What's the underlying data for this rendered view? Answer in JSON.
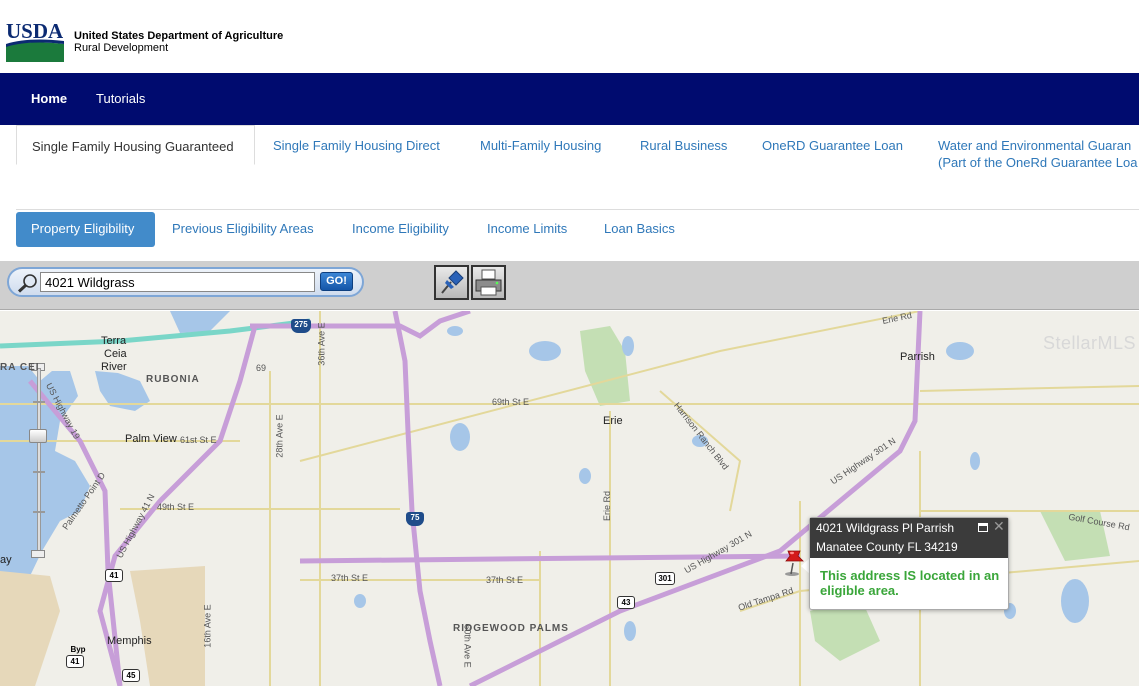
{
  "header": {
    "logo_text": "USDA",
    "agency_line1": "United States Department of Agriculture",
    "agency_line2": "Rural Development"
  },
  "nav": {
    "home": "Home",
    "tutorials": "Tutorials"
  },
  "program_tabs": [
    {
      "label": "Single Family Housing Guaranteed"
    },
    {
      "label": "Single Family Housing Direct"
    },
    {
      "label": "Multi-Family Housing"
    },
    {
      "label": "Rural Business"
    },
    {
      "label": "OneRD Guarantee Loan"
    },
    {
      "label": "Water and Environmental Guaran",
      "label2": "(Part of the OneRd Guarantee Loa"
    }
  ],
  "sub_tabs": [
    {
      "label": "Property Eligibility"
    },
    {
      "label": "Previous Eligibility Areas"
    },
    {
      "label": "Income Eligibility"
    },
    {
      "label": "Income Limits"
    },
    {
      "label": "Loan Basics"
    }
  ],
  "search": {
    "value": "4021 Wildgrass",
    "go_label": "GO!"
  },
  "map": {
    "labels": {
      "terra_ceia": "Terra",
      "terra_ceia2": "Ceia",
      "terra_ceia3": "River",
      "rubonia": "RUBONIA",
      "ra_cei": "RA CEI",
      "palm_view": "Palm View",
      "erie": "Erie",
      "parrish": "Parrish",
      "memphis": "Memphis",
      "ridgewood": "RIDGEWOOD PALMS",
      "bay": "ay",
      "watermark": "StellarMLS"
    },
    "streets": {
      "s69th": "69th St E",
      "s61st": "61st St E",
      "s49th": "49th St E",
      "s37th_a": "37th St E",
      "s37th_b": "37th St E",
      "us19": "US Highway 19",
      "us41": "US Highway 41 N",
      "us301_a": "US Highway 301 N",
      "us301_b": "US Highway 301 N",
      "harrison": "Harrison Ranch Blvd",
      "erie_rd": "Erie Rd",
      "erie_rd2": "Erie Rd",
      "golf": "Golf Course Rd",
      "old_tampa": "Old Tampa Rd",
      "palmetto": "Palmetto Point D",
      "ave36": "36th Ave E",
      "ave28": "28th Ave E",
      "ave16": "16th Ave E",
      "ave60": "60th Ave E",
      "ave69": "69"
    },
    "shields": {
      "i275": "275",
      "i75": "75",
      "us41": "41",
      "us301": "301",
      "sr43": "43",
      "sr45": "45",
      "byp": "Byp",
      "byp41": "41"
    }
  },
  "popup": {
    "address_line1": "4021 Wildgrass Pl Parrish",
    "address_line2": "Manatee County FL 34219",
    "result": "This address IS located in an eligible area."
  },
  "colors": {
    "nav_bg": "#000b6f",
    "active_subtab": "#428bca",
    "link": "#2f78b9",
    "eligible_green": "#3aa63a"
  }
}
